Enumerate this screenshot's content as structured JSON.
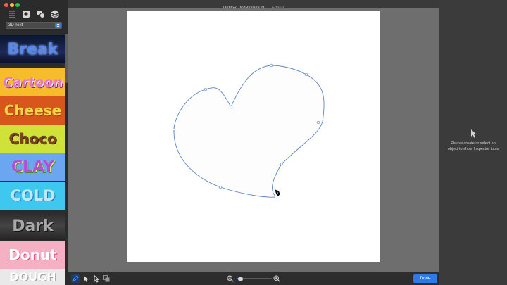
{
  "window": {
    "title": "Untitled 2048x2048 pt",
    "status": "— Edited"
  },
  "sidebar": {
    "category": "3D Text",
    "styles": [
      {
        "id": "break",
        "label": "Break"
      },
      {
        "id": "cartoon",
        "label": "Cartoon"
      },
      {
        "id": "cheese",
        "label": "Cheese"
      },
      {
        "id": "choco",
        "label": "Choco"
      },
      {
        "id": "clay",
        "label": "CLAY"
      },
      {
        "id": "cold",
        "label": "COLD"
      },
      {
        "id": "dark",
        "label": "Dark"
      },
      {
        "id": "donut",
        "label": "Donut"
      },
      {
        "id": "partial",
        "label": "DOUGH"
      }
    ]
  },
  "inspector": {
    "message": "Please create or select an object to show Inspector tools"
  },
  "bottombar": {
    "done_label": "Done",
    "zoom_level": 0.1
  },
  "colors": {
    "accent": "#2b7ce9",
    "path_stroke": "#5d84c0",
    "canvas_bg": "#6e6e6e",
    "panel_bg": "#2b2b2b"
  },
  "icons": {
    "sidebar_tools": [
      "list-icon",
      "photo-icon",
      "shapes-icon",
      "layers-icon"
    ],
    "bottom_tools": [
      "pen-icon",
      "select-arrow-icon",
      "direct-select-icon",
      "transform-icon"
    ]
  }
}
